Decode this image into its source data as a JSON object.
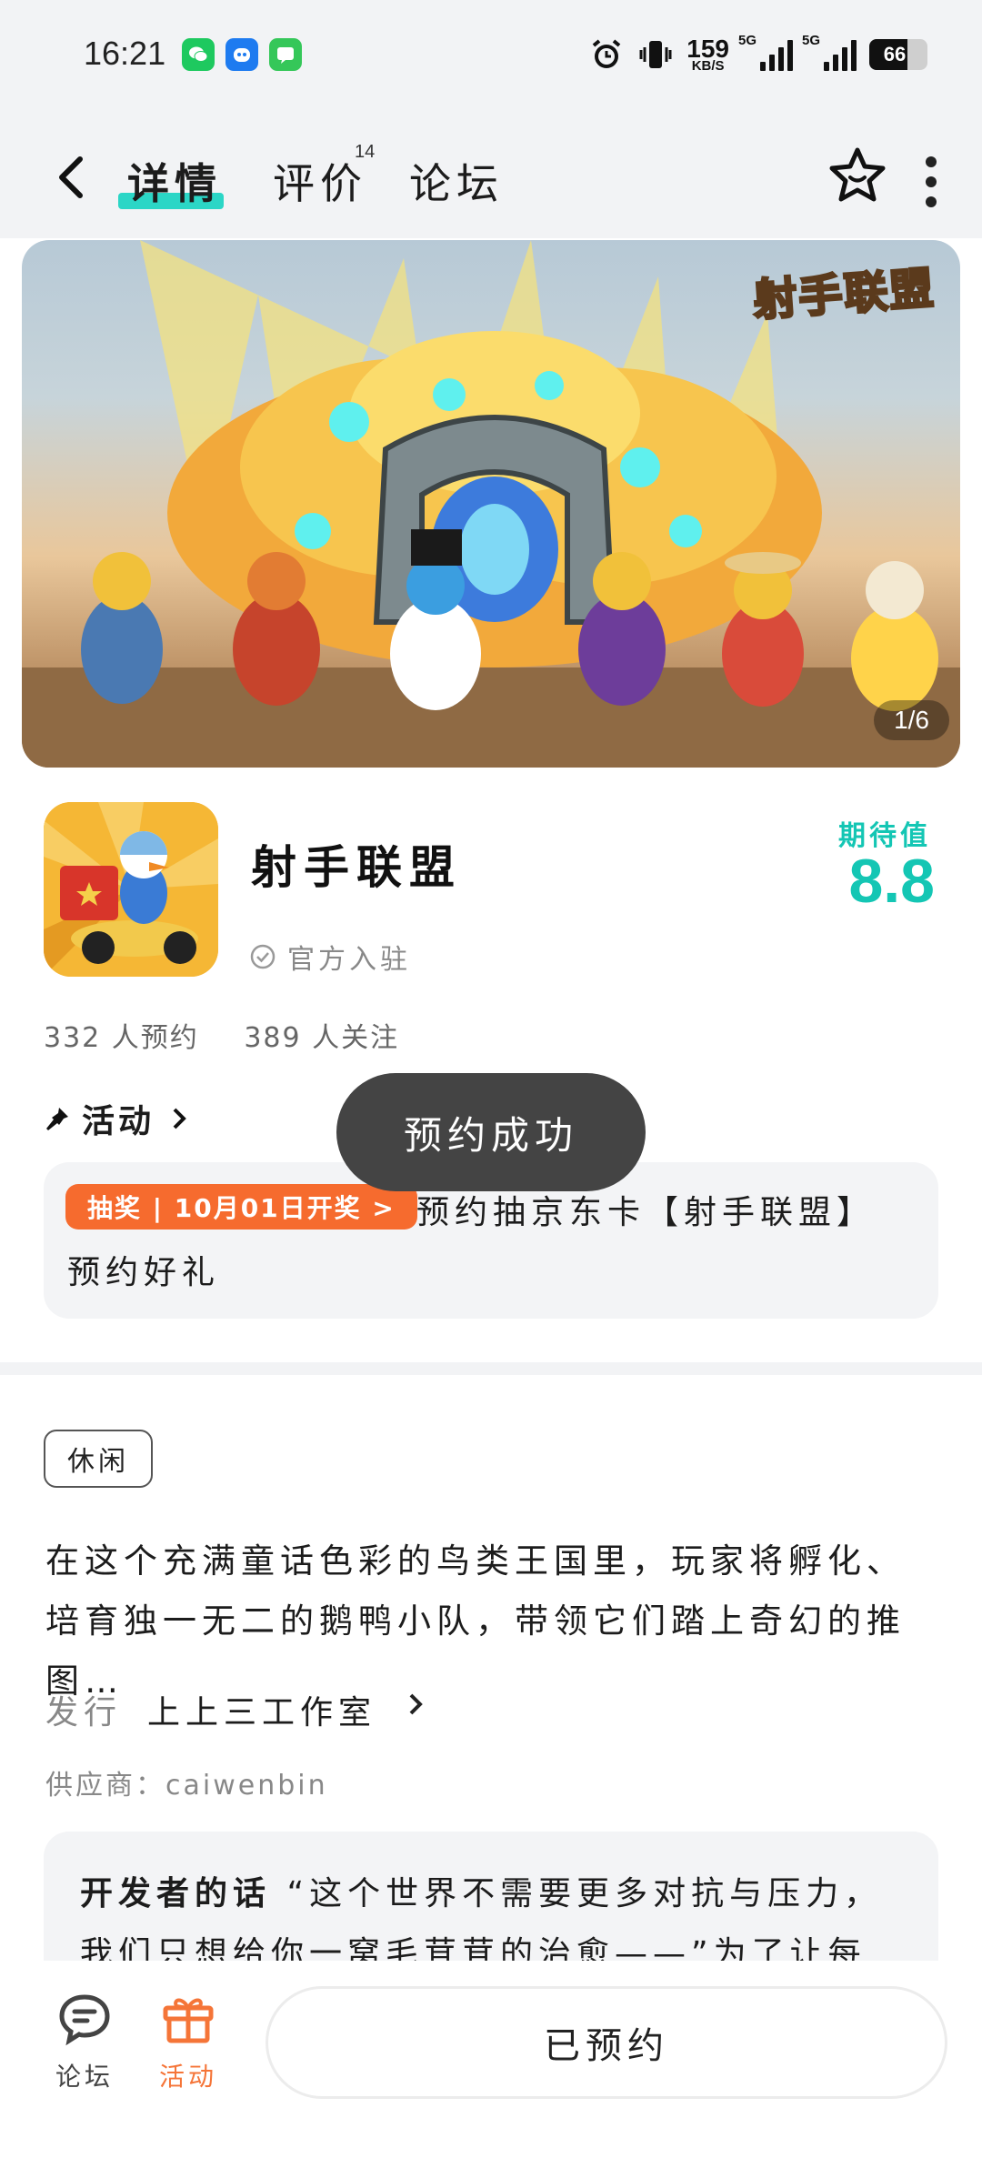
{
  "status_bar": {
    "time": "16:21",
    "network_speed": "159",
    "network_speed_unit": "KB/S",
    "signal1_label": "5G",
    "signal2_label": "5G",
    "battery": "66",
    "battery_level": 0.66
  },
  "header": {
    "tabs": [
      {
        "label": "详情",
        "active": true
      },
      {
        "label": "评价",
        "badge": "14"
      },
      {
        "label": "论坛"
      }
    ]
  },
  "banner": {
    "logo_text": "射手联盟",
    "counter": "1/6"
  },
  "game": {
    "name": "射手联盟",
    "verified_label": "官方入驻",
    "score_label": "期待值",
    "score": "8.8",
    "reservations": "332 人预约",
    "followers": "389 人关注"
  },
  "activity": {
    "heading": "活动",
    "toast": "预约成功",
    "tag": "抽奖 | 10月01日开奖 >",
    "line1": "预约抽京东卡【射手联盟】",
    "line2": "预约好礼"
  },
  "details": {
    "genre": "休闲",
    "description": "在这个充满童话色彩的鸟类王国里，玩家将孵化、培育独一无二的鹅鸭小队，带领它们踏上奇幻的推图…",
    "publisher_label": "发行",
    "publisher": "上上三工作室",
    "supplier": "供应商：caiwenbin",
    "dev_title": "开发者的话",
    "dev_text": "“这个世界不需要更多对抗与压力，我们只想给你一窝毛茸茸的治愈——”为了让每"
  },
  "bottom_bar": {
    "forum_label": "论坛",
    "activity_label": "活动",
    "reserved_label": "已预约"
  },
  "colors": {
    "accent_teal": "#14c6b4",
    "tab_underline": "#2bd6c6",
    "orange": "#f66b2e",
    "toast_bg": "#444444"
  }
}
